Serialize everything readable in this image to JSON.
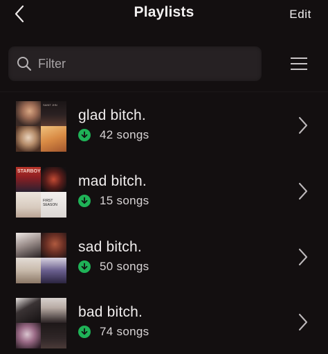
{
  "header": {
    "title": "Playlists",
    "edit_label": "Edit",
    "back_icon": "chevron-left-icon"
  },
  "filter": {
    "placeholder": "Filter",
    "value": "",
    "icon": "search-icon",
    "sort_icon": "hamburger-menu-icon"
  },
  "playlists": [
    {
      "name": "glad bitch.",
      "count_label": "42 songs",
      "downloaded": true,
      "artwork": {
        "tile_1_text": "",
        "tile_2_text": "SAINT JHN",
        "tile_3_text": "",
        "tile_4_text": ""
      }
    },
    {
      "name": "mad bitch.",
      "count_label": "15 songs",
      "downloaded": true,
      "artwork": {
        "tile_1_text": "STARBOY",
        "tile_2_text": "",
        "tile_3_text": "",
        "tile_4_text": "FIRST SEASON"
      }
    },
    {
      "name": "sad bitch.",
      "count_label": "50 songs",
      "downloaded": true,
      "artwork": {
        "tile_1_text": "",
        "tile_2_text": "",
        "tile_3_text": "",
        "tile_4_text": ""
      }
    },
    {
      "name": "bad bitch.",
      "count_label": "74 songs",
      "downloaded": true,
      "artwork": {
        "tile_1_text": "",
        "tile_2_text": "",
        "tile_3_text": "",
        "tile_4_text": ""
      }
    }
  ],
  "colors": {
    "background": "#130f10",
    "filter_bg": "#262123",
    "download_green": "#1fb257",
    "text_primary": "#f1eeee",
    "text_secondary": "#d8d4d5"
  }
}
